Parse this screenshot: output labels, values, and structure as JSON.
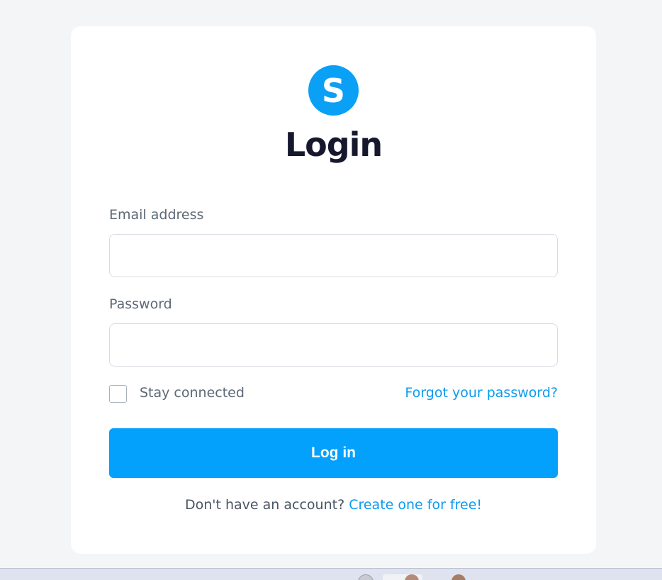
{
  "login": {
    "logo_letter": "S",
    "title": "Login",
    "email": {
      "label": "Email address",
      "value": "",
      "placeholder": ""
    },
    "password": {
      "label": "Password",
      "value": "",
      "placeholder": ""
    },
    "stay_connected": {
      "label": "Stay connected",
      "checked": false
    },
    "forgot_password": "Forgot your password?",
    "login_button": "Log in",
    "signup": {
      "prompt": "Don't have an account?",
      "link": "Create one for free!"
    }
  },
  "colors": {
    "accent": "#03a0fc",
    "title": "#16182e",
    "muted_text": "#5d6877",
    "background": "#f4f5f7"
  },
  "taskbar": {
    "icons": [
      "app-icon",
      "window-preview-icon",
      "avatar-icon",
      "avatar-icon"
    ]
  }
}
